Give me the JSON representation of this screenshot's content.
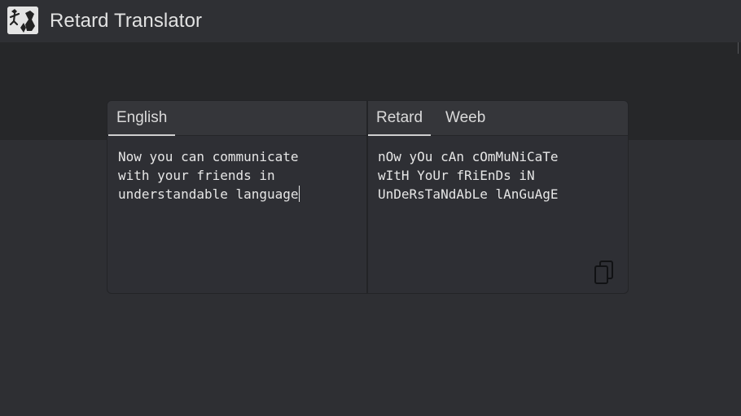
{
  "app": {
    "title": "Retard Translator",
    "logo_icon": "app-logo-icon"
  },
  "source": {
    "tabs": [
      {
        "label": "English",
        "active": true
      }
    ],
    "text_lines": [
      "Now you can communicate",
      "with your friends in",
      "understandable language"
    ]
  },
  "target": {
    "tabs": [
      {
        "label": "Retard",
        "active": true
      },
      {
        "label": "Weeb",
        "active": false
      }
    ],
    "text_lines": [
      "nOw yOu cAn cOmMuNiCaTe",
      "wItH YoUr fRiEnDs iN",
      "UnDeRsTaNdAbLe lAnGuAgE"
    ],
    "copy_icon": "copy-icon"
  },
  "colors": {
    "background": "#2e2f33",
    "header_band": "#262729",
    "titlebar": "#2f3034",
    "card": "#2e2f34",
    "tabbar": "#35363a",
    "text": "#e6e6e6"
  }
}
